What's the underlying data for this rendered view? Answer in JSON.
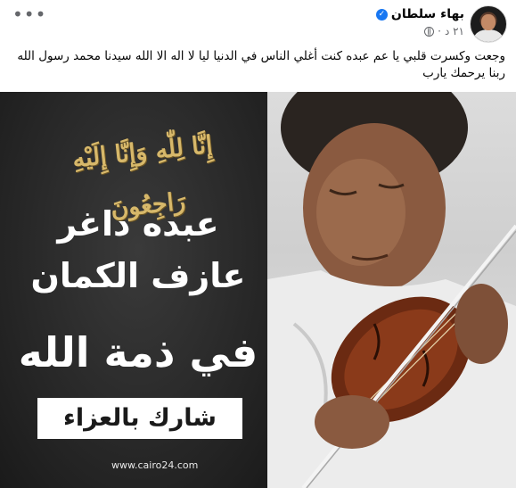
{
  "post": {
    "author": "بهاء سلطان",
    "timestamp": "٢١ د",
    "text": "وجعت وكسرت قلبي  يا عم عبده كنت أغلي الناس في الدنيا ليا  لا اله الا الله سيدنا محمد رسول الله ربنا يرحمك يارب",
    "options_glyph": "•••",
    "verified_glyph": "✓"
  },
  "image": {
    "calligraphy": "إِنَّا لِلّٰهِ وَإِنَّا إِلَيْهِ رَاجِعُونَ",
    "name_line": "عبده داغر",
    "role_line": "عازف الكمان",
    "condolence_line": "في ذمة الله",
    "share_label": "شارك بالعزاء",
    "website": "www.cairo24.com"
  },
  "colors": {
    "verified_badge": "#1877f2",
    "calligraphy_gold": "#d7b86a",
    "image_background": "#2b2b2b"
  },
  "icons": {
    "options": "more-options-icon",
    "verified": "verified-badge-icon",
    "audience": "globe-icon"
  }
}
